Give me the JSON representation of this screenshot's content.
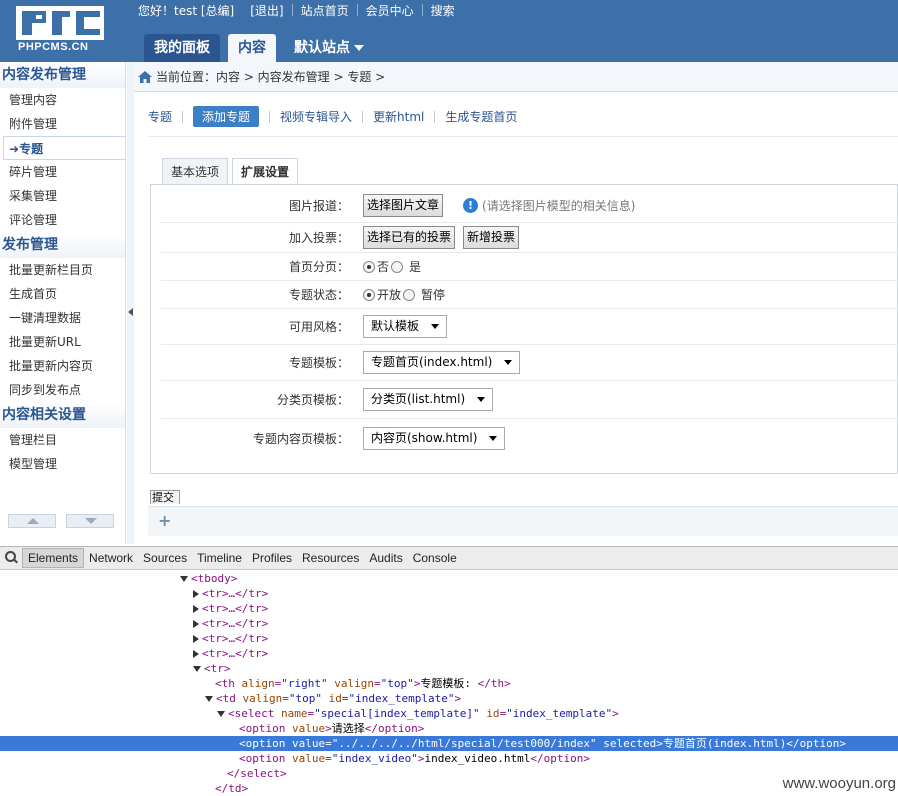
{
  "brand": {
    "logo_text": "PHPCMS.CN"
  },
  "topbar": {
    "greeting": "您好！test [总编]",
    "logout": "[退出]",
    "site_home": "站点首页",
    "member_center": "会员中心",
    "search": "搜索"
  },
  "nav": {
    "my_panel": "我的面板",
    "content": "内容",
    "default_site": "默认站点"
  },
  "sidebar": {
    "groups": [
      {
        "title": "内容发布管理",
        "items": [
          "管理内容",
          "附件管理",
          "专题",
          "碎片管理",
          "采集管理",
          "评论管理"
        ]
      },
      {
        "title": "发布管理",
        "items": [
          "批量更新栏目页",
          "生成首页",
          "一键清理数据",
          "批量更新URL",
          "批量更新内容页",
          "同步到发布点"
        ]
      },
      {
        "title": "内容相关设置",
        "items": [
          "管理栏目",
          "模型管理"
        ]
      }
    ],
    "active_item": "专题"
  },
  "breadcrumb": {
    "text": "当前位置：内容 > 内容发布管理 > 专题 >"
  },
  "subnav": {
    "special": "专题",
    "add_special": "添加专题",
    "video_import": "视频专辑导入",
    "update_html": "更新html",
    "gen_index": "生成专题首页"
  },
  "tabs": {
    "basic": "基本选项",
    "extended": "扩展设置"
  },
  "form": {
    "pic_news_label": "图片报道：",
    "pic_news_button": "选择图片文章",
    "pic_news_hint": "(请选择图片模型的相关信息)",
    "vote_label": "加入投票：",
    "vote_select_button": "选择已有的投票",
    "vote_new_button": "新增投票",
    "index_page_label": "首页分页：",
    "index_page_no": "否",
    "index_page_yes": "是",
    "status_label": "专题状态：",
    "status_open": "开放",
    "status_pause": "暂停",
    "style_label": "可用风格：",
    "style_value": "默认模板",
    "index_template_label": "专题模板：",
    "index_template_value": "专题首页(index.html)",
    "list_template_label": "分类页模板：",
    "list_template_value": "分类页(list.html)",
    "show_template_label": "专题内容页模板：",
    "show_template_value": "内容页(show.html)",
    "submit_partial": "提交"
  },
  "devtools": {
    "tabs": [
      "Elements",
      "Network",
      "Sources",
      "Timeline",
      "Profiles",
      "Resources",
      "Audits",
      "Console"
    ],
    "active_tab": "Elements",
    "lines": {
      "tbody": "<tbody>",
      "tr1": "<tr>…</tr>",
      "tr2": "<tr>…</tr>",
      "tr3": "<tr>…</tr>",
      "tr4": "<tr>…</tr>",
      "tr5": "<tr>…</tr>",
      "tr_open": "<tr>",
      "th_open": "<th ",
      "th_a1": "align",
      "th_v1": "\"right\"",
      "th_a2": "valign",
      "th_v2": "\"top\"",
      "th_text": "专题模板: ",
      "th_close": "</th>",
      "td_open": "<td ",
      "td_a1": "valign",
      "td_v1": "\"top\"",
      "td_a2": "id",
      "td_v2": "\"index_template\"",
      "select_open": "<select ",
      "sel_a1": "name",
      "sel_v1": "\"special[index_template]\"",
      "sel_a2": "id",
      "sel_v2": "\"index_template\"",
      "opt1_open": "<option ",
      "opt1_a": "value",
      "opt1_text": "请选择",
      "opt2_a": "value",
      "opt2_v": "\"../../../../html/special/test000/index\"",
      "opt2_attr": "selected",
      "opt2_text": "专题首页(index.html)",
      "opt3_v": "\"index_video\"",
      "opt3_text": "index_video.html",
      "option_close": "</option>",
      "select_close": "</select>",
      "td_close": "</td>"
    }
  },
  "watermark": "www.wooyun.org"
}
